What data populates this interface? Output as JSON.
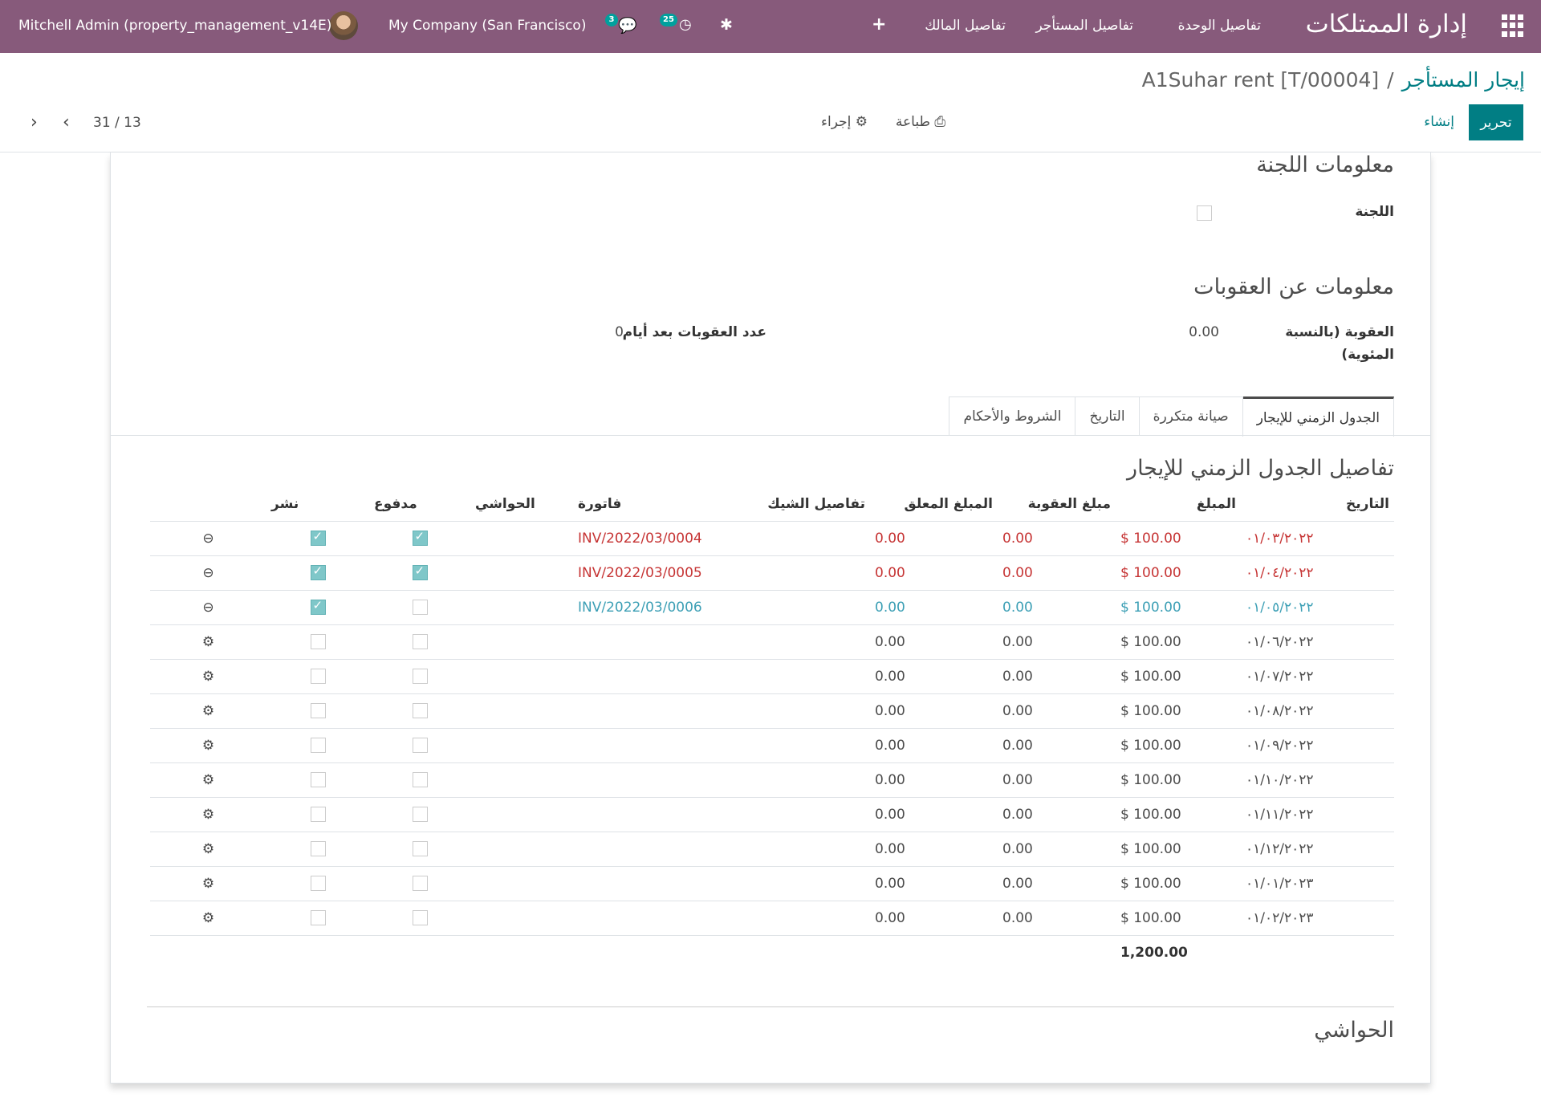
{
  "navbar": {
    "brand": "إدارة الممتلكات",
    "menu": [
      "تفاصيل الوحدة",
      "تفاصيل المستأجر",
      "تفاصيل المالك"
    ],
    "plus_icon": "plus-icon",
    "bug_icon": "bug-icon",
    "activity_badge": "25",
    "messages_badge": "3",
    "company": "My Company (San Francisco)",
    "user": "Mitchell Admin (property_management_v14E)"
  },
  "control_panel": {
    "breadcrumb_parent": "إيجار المستأجر",
    "breadcrumb_sep": "/",
    "breadcrumb_current": "A1Suhar rent [T/00004]",
    "edit": "تحرير",
    "create": "إنشاء",
    "print": "طباعة",
    "action": "إجراء",
    "pager": "31 / 13"
  },
  "committee": {
    "title": "معلومات اللجنة",
    "label": "اللجنة",
    "checked": false
  },
  "penalty": {
    "title": "معلومات عن العقوبات",
    "pct_label_1": "العقوبة (بالنسبة",
    "pct_label_2": "المئوية)",
    "pct_value": "0.00",
    "days_label": "عدد العقوبات بعد أيام",
    "days_value": "0"
  },
  "tabs": [
    "الجدول الزمني للإيجار",
    "صيانة متكررة",
    "التاريخ",
    "الشروط والأحكام"
  ],
  "schedule": {
    "title": "تفاصيل الجدول الزمني للإيجار",
    "headers": [
      "التاريخ",
      "المبلغ",
      "مبلغ العقوبة",
      "المبلغ المعلق",
      "تفاصيل الشيك",
      "فاتورة",
      "الحواشي",
      "مدفوع",
      "نشر"
    ],
    "rows": [
      {
        "date": "٠١/٠٣/٢٠٢٢",
        "amount": "100.00 $",
        "penalty": "0.00",
        "pending": "0.00",
        "invoice": "INV/2022/03/0004",
        "paid": true,
        "posted": true,
        "status": "red"
      },
      {
        "date": "٠١/٠٤/٢٠٢٢",
        "amount": "100.00 $",
        "penalty": "0.00",
        "pending": "0.00",
        "invoice": "INV/2022/03/0005",
        "paid": true,
        "posted": true,
        "status": "red"
      },
      {
        "date": "٠١/٠٥/٢٠٢٢",
        "amount": "100.00 $",
        "penalty": "0.00",
        "pending": "0.00",
        "invoice": "INV/2022/03/0006",
        "paid": false,
        "posted": true,
        "status": "blue"
      },
      {
        "date": "٠١/٠٦/٢٠٢٢",
        "amount": "100.00 $",
        "penalty": "0.00",
        "pending": "0.00",
        "invoice": "",
        "paid": false,
        "posted": false,
        "status": "normal"
      },
      {
        "date": "٠١/٠٧/٢٠٢٢",
        "amount": "100.00 $",
        "penalty": "0.00",
        "pending": "0.00",
        "invoice": "",
        "paid": false,
        "posted": false,
        "status": "normal"
      },
      {
        "date": "٠١/٠٨/٢٠٢٢",
        "amount": "100.00 $",
        "penalty": "0.00",
        "pending": "0.00",
        "invoice": "",
        "paid": false,
        "posted": false,
        "status": "normal"
      },
      {
        "date": "٠١/٠٩/٢٠٢٢",
        "amount": "100.00 $",
        "penalty": "0.00",
        "pending": "0.00",
        "invoice": "",
        "paid": false,
        "posted": false,
        "status": "normal"
      },
      {
        "date": "٠١/١٠/٢٠٢٢",
        "amount": "100.00 $",
        "penalty": "0.00",
        "pending": "0.00",
        "invoice": "",
        "paid": false,
        "posted": false,
        "status": "normal"
      },
      {
        "date": "٠١/١١/٢٠٢٢",
        "amount": "100.00 $",
        "penalty": "0.00",
        "pending": "0.00",
        "invoice": "",
        "paid": false,
        "posted": false,
        "status": "normal"
      },
      {
        "date": "٠١/١٢/٢٠٢٢",
        "amount": "100.00 $",
        "penalty": "0.00",
        "pending": "0.00",
        "invoice": "",
        "paid": false,
        "posted": false,
        "status": "normal"
      },
      {
        "date": "٠١/٠١/٢٠٢٣",
        "amount": "100.00 $",
        "penalty": "0.00",
        "pending": "0.00",
        "invoice": "",
        "paid": false,
        "posted": false,
        "status": "normal"
      },
      {
        "date": "٠١/٠٢/٢٠٢٣",
        "amount": "100.00 $",
        "penalty": "0.00",
        "pending": "0.00",
        "invoice": "",
        "paid": false,
        "posted": false,
        "status": "normal"
      }
    ],
    "total": "1,200.00"
  },
  "notes": {
    "title": "الحواشي"
  },
  "colors": {
    "navbar": "#875a7b",
    "primary": "#017e84",
    "red": "#c63434",
    "blue": "#3c9fb5"
  }
}
